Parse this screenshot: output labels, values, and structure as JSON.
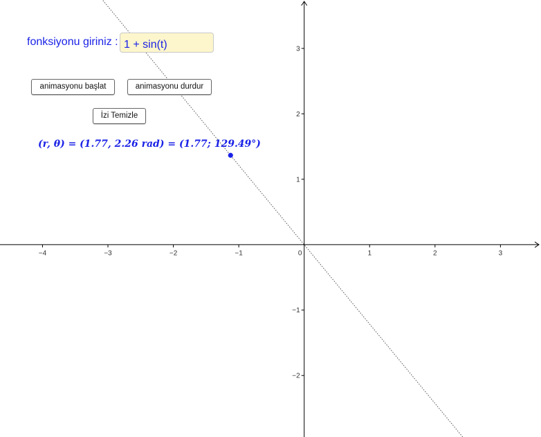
{
  "input": {
    "label": "fonksiyonu giriniz :",
    "value": "1 + sin(t)"
  },
  "buttons": {
    "start": "animasyonu başlat",
    "stop": "animasyonu durdur",
    "clear": "İzi Temizle"
  },
  "readout": {
    "text": "(r, θ) = (1.77, 2.26 rad) = (1.77; 129.49°)"
  },
  "graph": {
    "x_ticks": [
      "−4",
      "−3",
      "−2",
      "−1",
      "0",
      "1",
      "2",
      "3"
    ],
    "x_tick_values": [
      -4,
      -3,
      -2,
      -1,
      0,
      1,
      2,
      3
    ],
    "y_ticks": [
      "3",
      "2",
      "1",
      "−1",
      "−2"
    ],
    "y_tick_values": [
      3,
      2,
      1,
      -1,
      -2
    ],
    "x_range": [
      -4.65,
      3.62
    ],
    "y_range": [
      -2.94,
      3.74
    ],
    "point": {
      "r": 1.77,
      "theta_rad": 2.26
    },
    "colors": {
      "axis": "#000000",
      "point": "#1a22e6",
      "guide_line": "#555555",
      "text": "#1a22e6",
      "input_bg": "#fdf6cc"
    }
  }
}
